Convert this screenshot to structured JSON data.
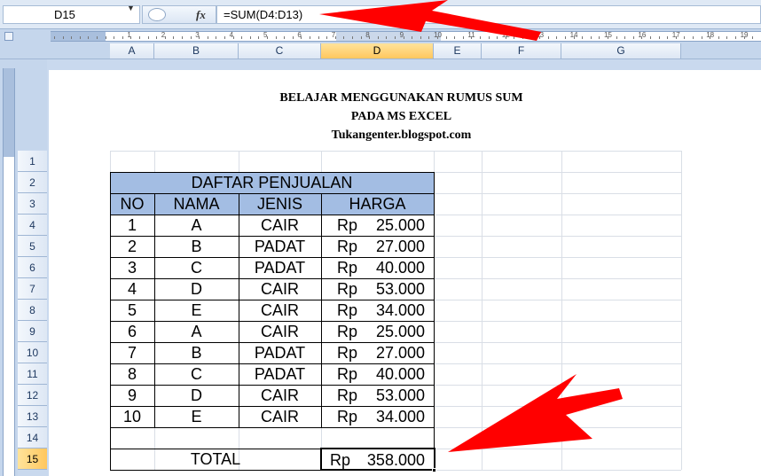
{
  "formula_bar": {
    "name_box": "D15",
    "fx_label": "fx",
    "formula": "=SUM(D4:D13)"
  },
  "ruler": {
    "numbers": [
      "1",
      "2",
      "3",
      "4",
      "5",
      "6",
      "7",
      "8",
      "9",
      "10",
      "11",
      "12",
      "13",
      "14",
      "15",
      "16",
      "17",
      "18",
      "19"
    ]
  },
  "columns": [
    "A",
    "B",
    "C",
    "D",
    "E",
    "F",
    "G"
  ],
  "active_column": "D",
  "rows": [
    "1",
    "2",
    "3",
    "4",
    "5",
    "6",
    "7",
    "8",
    "9",
    "10",
    "11",
    "12",
    "13",
    "14",
    "15"
  ],
  "active_row": "15",
  "page": {
    "title_line1": "BELAJAR MENGGUNAKAN RUMUS SUM",
    "title_line2": "PADA MS EXCEL",
    "title_line3": "Tukangenter.blogspot.com"
  },
  "table": {
    "caption": "DAFTAR PENJUALAN",
    "headers": [
      "NO",
      "NAMA",
      "JENIS",
      "HARGA"
    ],
    "currency": "Rp",
    "rows": [
      {
        "no": "1",
        "nama": "A",
        "jenis": "CAIR",
        "harga": "25.000"
      },
      {
        "no": "2",
        "nama": "B",
        "jenis": "PADAT",
        "harga": "27.000"
      },
      {
        "no": "3",
        "nama": "C",
        "jenis": "PADAT",
        "harga": "40.000"
      },
      {
        "no": "4",
        "nama": "D",
        "jenis": "CAIR",
        "harga": "53.000"
      },
      {
        "no": "5",
        "nama": "E",
        "jenis": "CAIR",
        "harga": "34.000"
      },
      {
        "no": "6",
        "nama": "A",
        "jenis": "CAIR",
        "harga": "25.000"
      },
      {
        "no": "7",
        "nama": "B",
        "jenis": "PADAT",
        "harga": "27.000"
      },
      {
        "no": "8",
        "nama": "C",
        "jenis": "PADAT",
        "harga": "40.000"
      },
      {
        "no": "9",
        "nama": "D",
        "jenis": "CAIR",
        "harga": "53.000"
      },
      {
        "no": "10",
        "nama": "E",
        "jenis": "CAIR",
        "harga": "34.000"
      }
    ],
    "total_label": "TOTAL",
    "total_value": "358.000"
  },
  "colors": {
    "header_fill": "#a3bde3",
    "arrow": "#ff0000",
    "active_header": "#ffc75e"
  },
  "annotations": [
    "red-arrow-formula",
    "red-arrow-total"
  ]
}
